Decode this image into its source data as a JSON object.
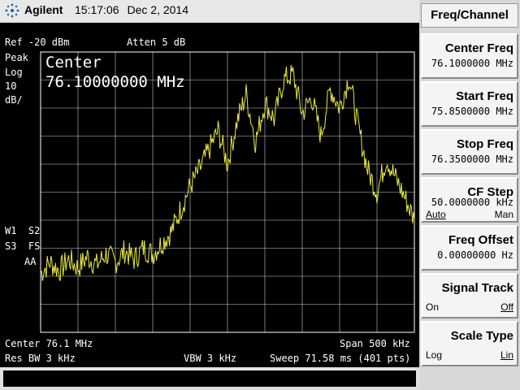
{
  "header": {
    "brand": "Agilent",
    "time": "15:17:06",
    "date": "Dec 2, 2014"
  },
  "screen": {
    "ref": "Ref -20 dBm",
    "atten": "Atten 5 dB",
    "detector": "Peak",
    "scale_type": "Log",
    "scale_value": "10",
    "scale_unit": "dB/",
    "active_function_label": "Center",
    "active_function_value": "76.10000000 MHz",
    "trace_flags": [
      "W1  S2",
      "S3  FS",
      "AA"
    ],
    "center": "Center 76.1 MHz",
    "span": "Span 500 kHz",
    "rbw": "Res BW 3 kHz",
    "vbw": "VBW 3 kHz",
    "sweep": "Sweep 71.58 ms (401 pts)"
  },
  "colors": {
    "trace": "#e8e84a",
    "grid": "#ffffff",
    "screen_bg": "#000000"
  },
  "menu": {
    "title": "Freq/Channel",
    "softkeys": [
      {
        "label": "Center Freq",
        "value": "76.1000000 MHz"
      },
      {
        "label": "Start Freq",
        "value": "75.8500000 MHz"
      },
      {
        "label": "Stop Freq",
        "value": "76.3500000 MHz"
      },
      {
        "label": "CF Step",
        "value": "50.0000000 kHz",
        "left": "Auto",
        "right": "Man"
      },
      {
        "label": "Freq Offset",
        "value": "0.00000000  Hz"
      },
      {
        "label": "Signal Track",
        "left": "On",
        "right": "Off"
      },
      {
        "label": "Scale Type",
        "left": "Log",
        "right": "Lin"
      }
    ]
  },
  "chart_data": {
    "type": "line",
    "xlabel": "",
    "ylabel": "",
    "xlim": [
      75.85,
      76.35
    ],
    "ylim": [
      -120,
      -20
    ],
    "grid": true,
    "series": [
      {
        "x": [
          75.85,
          75.8625,
          75.875,
          75.8875,
          75.9,
          75.9125,
          75.925,
          75.9375,
          75.95,
          75.9625,
          75.975,
          75.9875,
          76.0,
          76.0125,
          76.025,
          76.0375,
          76.05,
          76.0625,
          76.075,
          76.0875,
          76.1,
          76.1125,
          76.125,
          76.1375,
          76.15,
          76.1625,
          76.175,
          76.1875,
          76.2,
          76.2125,
          76.225,
          76.2375,
          76.25,
          76.2625,
          76.275,
          76.2875,
          76.3,
          76.3125,
          76.325,
          76.3375,
          76.35
        ],
        "values": [
          -99,
          -95,
          -98,
          -94,
          -97,
          -93,
          -96,
          -92,
          -95,
          -91,
          -94,
          -90,
          -92,
          -88,
          -84,
          -76,
          -68,
          -62,
          -55,
          -48,
          -60,
          -45,
          -35,
          -52,
          -38,
          -44,
          -30,
          -28,
          -42,
          -36,
          -50,
          -33,
          -40,
          -29,
          -47,
          -62,
          -70,
          -58,
          -65,
          -72,
          -80
        ]
      }
    ]
  }
}
